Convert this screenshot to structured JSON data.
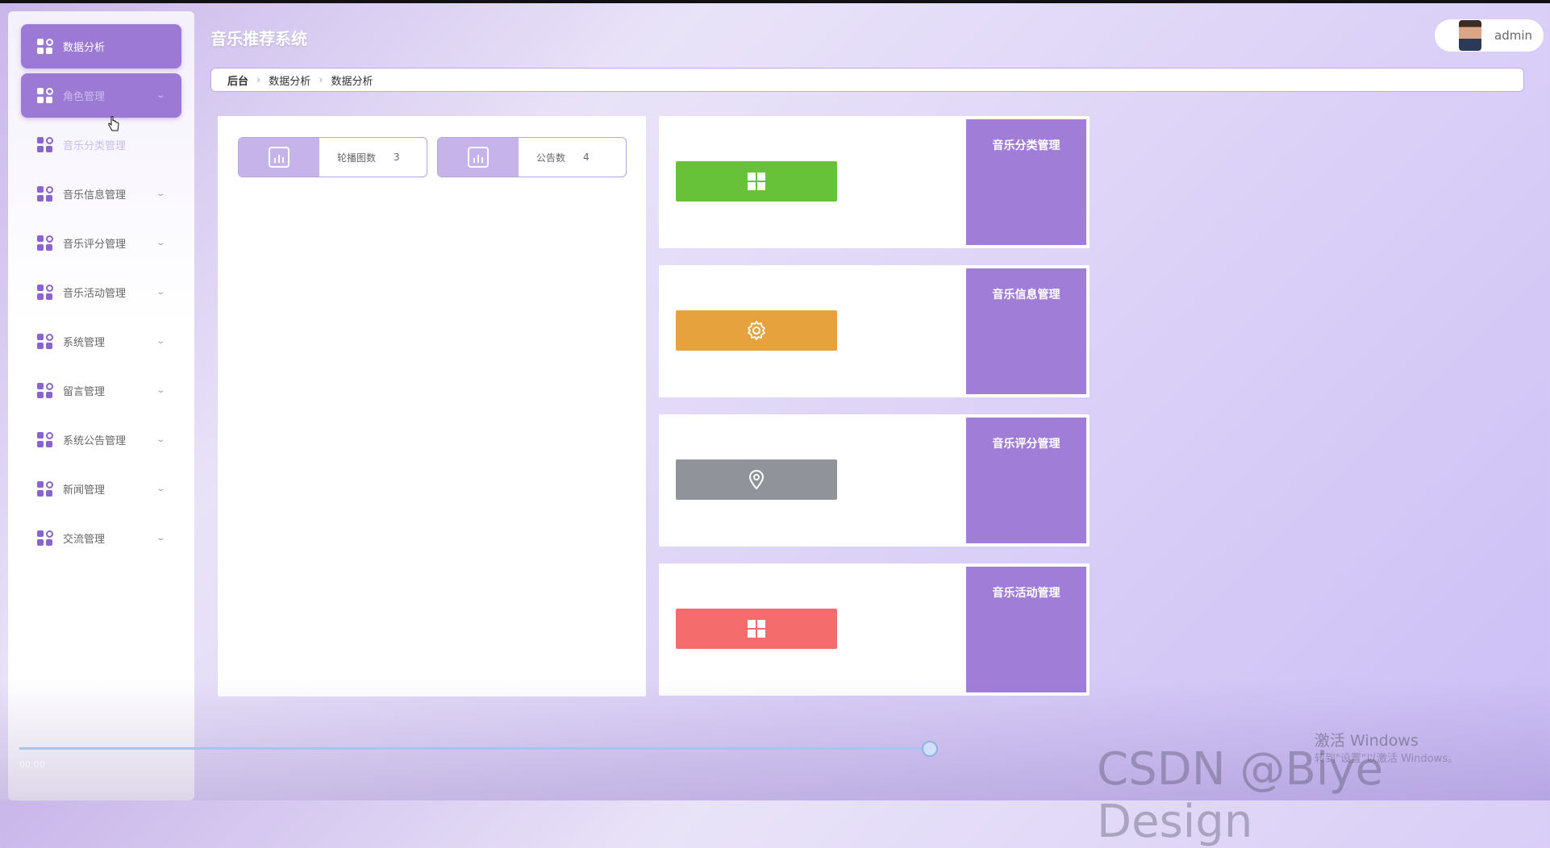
{
  "app": {
    "title": "音乐推荐系统"
  },
  "user": {
    "name": "admin"
  },
  "breadcrumb": {
    "items": [
      "后台",
      "数据分析",
      "数据分析"
    ]
  },
  "sidebar": {
    "items": [
      {
        "label": "数据分析"
      },
      {
        "label": "角色管理"
      },
      {
        "label": "音乐分类管理"
      },
      {
        "label": "音乐信息管理"
      },
      {
        "label": "音乐评分管理"
      },
      {
        "label": "音乐活动管理"
      },
      {
        "label": "系统管理"
      },
      {
        "label": "留言管理"
      },
      {
        "label": "系统公告管理"
      },
      {
        "label": "新闻管理"
      },
      {
        "label": "交流管理"
      }
    ]
  },
  "stats": [
    {
      "label": "轮播图数",
      "value": "3"
    },
    {
      "label": "公告数",
      "value": "4"
    }
  ],
  "cards": [
    {
      "title": "音乐分类管理",
      "color": "#67c23a",
      "icon": "grid-icon"
    },
    {
      "title": "音乐信息管理",
      "color": "#e6a23c",
      "icon": "gear-icon"
    },
    {
      "title": "音乐评分管理",
      "color": "#909399",
      "icon": "location-pin-icon"
    },
    {
      "title": "音乐活动管理",
      "color": "#f56c6c",
      "icon": "grid-icon"
    }
  ],
  "overlay": {
    "activate": "激活 Windows",
    "activate_sub": "转到\"设置\"以激活 Windows。",
    "watermark": "CSDN @Biye Design",
    "time": "00:00"
  }
}
